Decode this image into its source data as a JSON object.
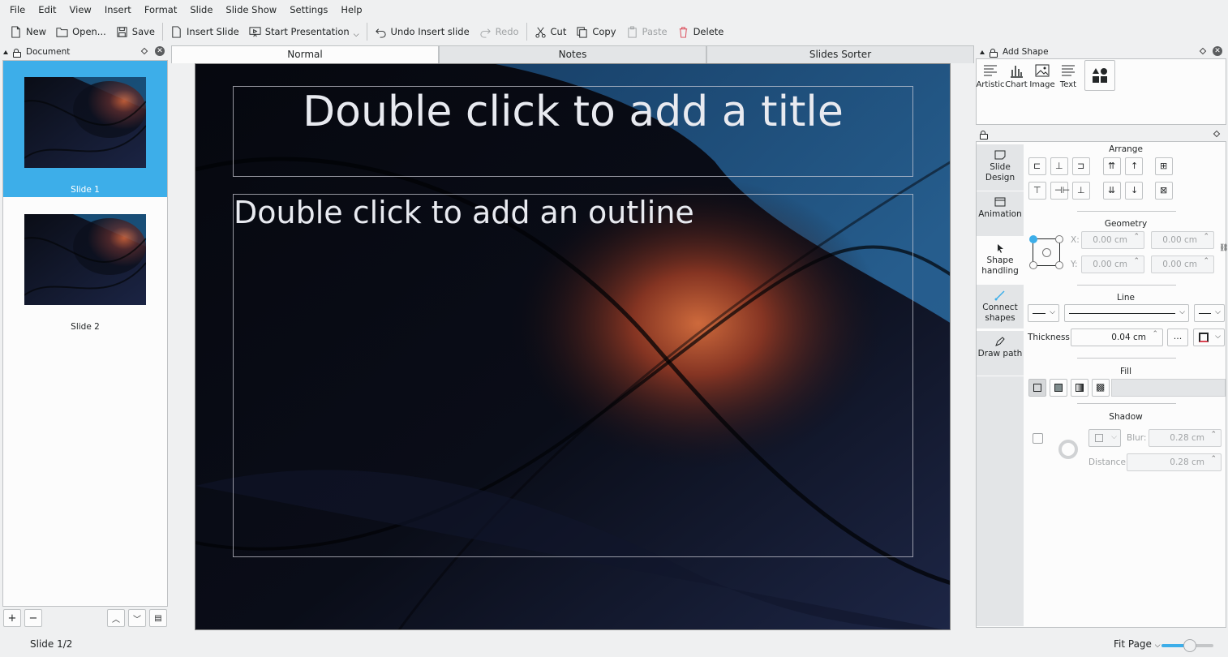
{
  "menu": [
    "File",
    "Edit",
    "View",
    "Insert",
    "Format",
    "Slide",
    "Slide Show",
    "Settings",
    "Help"
  ],
  "toolbar": {
    "new": "New",
    "open": "Open...",
    "save": "Save",
    "insert_slide": "Insert Slide",
    "start_presentation": "Start Presentation",
    "undo": "Undo Insert slide",
    "redo": "Redo",
    "cut": "Cut",
    "copy": "Copy",
    "paste": "Paste",
    "delete": "Delete"
  },
  "document_dock": {
    "title": "Document",
    "slides": [
      {
        "label": "Slide 1",
        "selected": true
      },
      {
        "label": "Slide 2",
        "selected": false
      }
    ]
  },
  "view_tabs": [
    "Normal",
    "Notes",
    "Slides Sorter"
  ],
  "slide": {
    "title_placeholder": "Double click to add a title",
    "outline_placeholder": "Double click to add an outline"
  },
  "add_shape": {
    "title": "Add Shape",
    "items": [
      "Artistic",
      "Chart",
      "Image",
      "Text"
    ]
  },
  "tool_tabs": [
    {
      "label": "Slide Design",
      "icon": "slide-design-icon"
    },
    {
      "label": "Animation",
      "icon": "animation-icon"
    },
    {
      "label": "Shape handling",
      "icon": "pointer-icon"
    },
    {
      "label": "Connect shapes",
      "icon": "connector-icon"
    },
    {
      "label": "Draw path",
      "icon": "pen-icon"
    }
  ],
  "options": {
    "arrange": "Arrange",
    "geometry": "Geometry",
    "x_label": "X:",
    "y_label": "Y:",
    "x_value": "0.00 cm",
    "y_value": "0.00 cm",
    "w_value": "0.00 cm",
    "h_value": "0.00 cm",
    "line": "Line",
    "thickness_label": "Thickness:",
    "thickness_value": "0.04 cm",
    "more": "...",
    "fill": "Fill",
    "shadow": "Shadow",
    "blur_label": "Blur:",
    "blur_value": "0.28 cm",
    "distance_label": "Distance:",
    "distance_value": "0.28 cm"
  },
  "status": {
    "slide_pos": "Slide 1/2",
    "zoom_mode": "Fit Page",
    "zoom_fraction": 0.55
  },
  "colors": {
    "accent": "#3daee9",
    "window": "#eff0f1",
    "panel": "#fcfcfc"
  }
}
